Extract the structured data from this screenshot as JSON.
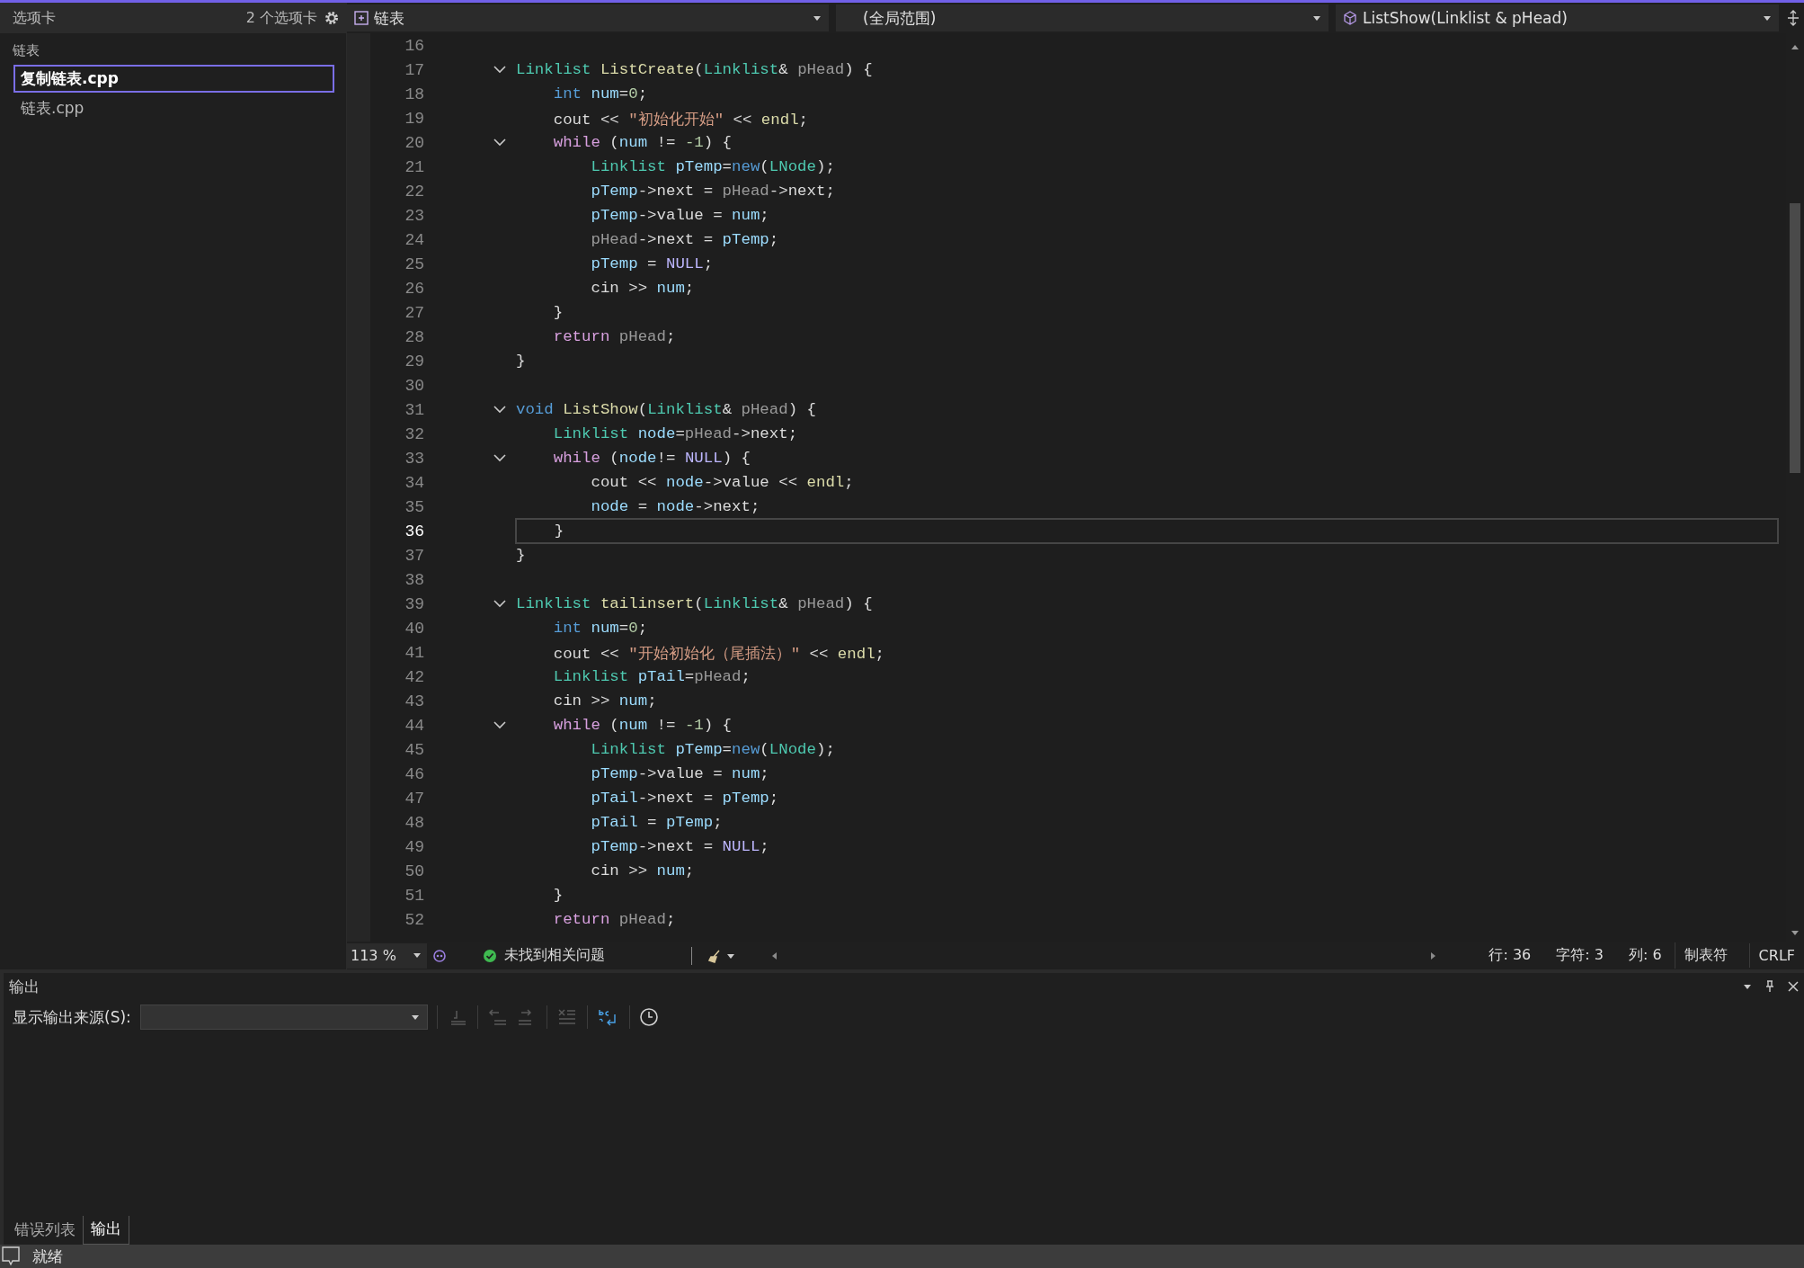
{
  "tabs_panel": {
    "title": "选项卡",
    "count": "2 个选项卡",
    "groups": [
      {
        "label": "链表",
        "files": [
          {
            "name": "复制链表.cpp",
            "selected": true
          },
          {
            "name": "链表.cpp",
            "selected": false
          }
        ]
      }
    ]
  },
  "navigation_bar": {
    "project": "链表",
    "scope": "(全局范围)",
    "member": "ListShow(Linklist & pHead)"
  },
  "editor": {
    "lines": [
      {
        "number": "16",
        "fold": false,
        "current": false
      },
      {
        "number": "17",
        "fold": true,
        "current": false,
        "tokens": [
          {
            "kind": "type",
            "text": "Linklist "
          },
          {
            "kind": "func",
            "text": "ListCreate"
          },
          {
            "kind": "plain",
            "text": "("
          },
          {
            "kind": "type",
            "text": "Linklist"
          },
          {
            "kind": "plain",
            "text": "& "
          },
          {
            "kind": "param",
            "text": "pHead"
          },
          {
            "kind": "plain",
            "text": ") {"
          }
        ]
      },
      {
        "number": "18",
        "fold": false,
        "current": false,
        "tokens": [
          {
            "kind": "kw",
            "text": "    int "
          },
          {
            "kind": "var",
            "text": "num"
          },
          {
            "kind": "plain",
            "text": "="
          },
          {
            "kind": "num",
            "text": "0"
          },
          {
            "kind": "plain",
            "text": ";"
          }
        ]
      },
      {
        "number": "19",
        "fold": false,
        "current": false,
        "tokens": [
          {
            "kind": "plain",
            "text": "    cout << "
          },
          {
            "kind": "str",
            "text": "\"初始化开始\""
          },
          {
            "kind": "plain",
            "text": " << "
          },
          {
            "kind": "func",
            "text": "endl"
          },
          {
            "kind": "plain",
            "text": ";"
          }
        ]
      },
      {
        "number": "20",
        "fold": true,
        "current": false,
        "tokens": [
          {
            "kind": "ctrl",
            "text": "    while"
          },
          {
            "kind": "plain",
            "text": " ("
          },
          {
            "kind": "var",
            "text": "num"
          },
          {
            "kind": "plain",
            "text": " != "
          },
          {
            "kind": "num",
            "text": "-1"
          },
          {
            "kind": "plain",
            "text": ") {"
          }
        ]
      },
      {
        "number": "21",
        "fold": false,
        "current": false,
        "tokens": [
          {
            "kind": "type",
            "text": "        Linklist "
          },
          {
            "kind": "var",
            "text": "pTemp"
          },
          {
            "kind": "plain",
            "text": "="
          },
          {
            "kind": "kw",
            "text": "new"
          },
          {
            "kind": "plain",
            "text": "("
          },
          {
            "kind": "type",
            "text": "LNode"
          },
          {
            "kind": "plain",
            "text": ");"
          }
        ]
      },
      {
        "number": "22",
        "fold": false,
        "current": false,
        "tokens": [
          {
            "kind": "var",
            "text": "        pTemp"
          },
          {
            "kind": "plain",
            "text": "->next = "
          },
          {
            "kind": "param",
            "text": "pHead"
          },
          {
            "kind": "plain",
            "text": "->next;"
          }
        ]
      },
      {
        "number": "23",
        "fold": false,
        "current": false,
        "tokens": [
          {
            "kind": "var",
            "text": "        pTemp"
          },
          {
            "kind": "plain",
            "text": "->value = "
          },
          {
            "kind": "var",
            "text": "num"
          },
          {
            "kind": "plain",
            "text": ";"
          }
        ]
      },
      {
        "number": "24",
        "fold": false,
        "current": false,
        "tokens": [
          {
            "kind": "param",
            "text": "        pHead"
          },
          {
            "kind": "plain",
            "text": "->next = "
          },
          {
            "kind": "var",
            "text": "pTemp"
          },
          {
            "kind": "plain",
            "text": ";"
          }
        ]
      },
      {
        "number": "25",
        "fold": false,
        "current": false,
        "tokens": [
          {
            "kind": "var",
            "text": "        pTemp"
          },
          {
            "kind": "plain",
            "text": " = "
          },
          {
            "kind": "macro",
            "text": "NULL"
          },
          {
            "kind": "plain",
            "text": ";"
          }
        ]
      },
      {
        "number": "26",
        "fold": false,
        "current": false,
        "tokens": [
          {
            "kind": "plain",
            "text": "        cin >> "
          },
          {
            "kind": "var",
            "text": "num"
          },
          {
            "kind": "plain",
            "text": ";"
          }
        ]
      },
      {
        "number": "27",
        "fold": false,
        "current": false,
        "tokens": [
          {
            "kind": "plain",
            "text": "    }"
          }
        ]
      },
      {
        "number": "28",
        "fold": false,
        "current": false,
        "tokens": [
          {
            "kind": "ctrl",
            "text": "    return "
          },
          {
            "kind": "param",
            "text": "pHead"
          },
          {
            "kind": "plain",
            "text": ";"
          }
        ]
      },
      {
        "number": "29",
        "fold": false,
        "current": false,
        "tokens": [
          {
            "kind": "plain",
            "text": "}"
          }
        ]
      },
      {
        "number": "30",
        "fold": false,
        "current": false
      },
      {
        "number": "31",
        "fold": true,
        "current": false,
        "tokens": [
          {
            "kind": "kw",
            "text": "void "
          },
          {
            "kind": "func",
            "text": "ListShow"
          },
          {
            "kind": "plain",
            "text": "("
          },
          {
            "kind": "type",
            "text": "Linklist"
          },
          {
            "kind": "plain",
            "text": "& "
          },
          {
            "kind": "param",
            "text": "pHead"
          },
          {
            "kind": "plain",
            "text": ") {"
          }
        ]
      },
      {
        "number": "32",
        "fold": false,
        "current": false,
        "tokens": [
          {
            "kind": "type",
            "text": "    Linklist "
          },
          {
            "kind": "var",
            "text": "node"
          },
          {
            "kind": "plain",
            "text": "="
          },
          {
            "kind": "param",
            "text": "pHead"
          },
          {
            "kind": "plain",
            "text": "->next;"
          }
        ]
      },
      {
        "number": "33",
        "fold": true,
        "current": false,
        "tokens": [
          {
            "kind": "ctrl",
            "text": "    while"
          },
          {
            "kind": "plain",
            "text": " ("
          },
          {
            "kind": "var",
            "text": "node"
          },
          {
            "kind": "plain",
            "text": "!= "
          },
          {
            "kind": "macro",
            "text": "NULL"
          },
          {
            "kind": "plain",
            "text": ") {"
          }
        ]
      },
      {
        "number": "34",
        "fold": false,
        "current": false,
        "tokens": [
          {
            "kind": "plain",
            "text": "        cout << "
          },
          {
            "kind": "var",
            "text": "node"
          },
          {
            "kind": "plain",
            "text": "->value << "
          },
          {
            "kind": "func",
            "text": "endl"
          },
          {
            "kind": "plain",
            "text": ";"
          }
        ]
      },
      {
        "number": "35",
        "fold": false,
        "current": false,
        "tokens": [
          {
            "kind": "var",
            "text": "        node"
          },
          {
            "kind": "plain",
            "text": " = "
          },
          {
            "kind": "var",
            "text": "node"
          },
          {
            "kind": "plain",
            "text": "->next;"
          }
        ]
      },
      {
        "number": "36",
        "fold": false,
        "current": true,
        "tokens": [
          {
            "kind": "plain",
            "text": "    }"
          }
        ]
      },
      {
        "number": "37",
        "fold": false,
        "current": false,
        "tokens": [
          {
            "kind": "plain",
            "text": "}"
          }
        ]
      },
      {
        "number": "38",
        "fold": false,
        "current": false
      },
      {
        "number": "39",
        "fold": true,
        "current": false,
        "tokens": [
          {
            "kind": "type",
            "text": "Linklist "
          },
          {
            "kind": "func",
            "text": "tailinsert"
          },
          {
            "kind": "plain",
            "text": "("
          },
          {
            "kind": "type",
            "text": "Linklist"
          },
          {
            "kind": "plain",
            "text": "& "
          },
          {
            "kind": "param",
            "text": "pHead"
          },
          {
            "kind": "plain",
            "text": ") {"
          }
        ]
      },
      {
        "number": "40",
        "fold": false,
        "current": false,
        "tokens": [
          {
            "kind": "kw",
            "text": "    int "
          },
          {
            "kind": "var",
            "text": "num"
          },
          {
            "kind": "plain",
            "text": "="
          },
          {
            "kind": "num",
            "text": "0"
          },
          {
            "kind": "plain",
            "text": ";"
          }
        ]
      },
      {
        "number": "41",
        "fold": false,
        "current": false,
        "tokens": [
          {
            "kind": "plain",
            "text": "    cout << "
          },
          {
            "kind": "str",
            "text": "\"开始初始化（尾插法）\""
          },
          {
            "kind": "plain",
            "text": " << "
          },
          {
            "kind": "func",
            "text": "endl"
          },
          {
            "kind": "plain",
            "text": ";"
          }
        ]
      },
      {
        "number": "42",
        "fold": false,
        "current": false,
        "tokens": [
          {
            "kind": "type",
            "text": "    Linklist "
          },
          {
            "kind": "var",
            "text": "pTail"
          },
          {
            "kind": "plain",
            "text": "="
          },
          {
            "kind": "param",
            "text": "pHead"
          },
          {
            "kind": "plain",
            "text": ";"
          }
        ]
      },
      {
        "number": "43",
        "fold": false,
        "current": false,
        "tokens": [
          {
            "kind": "plain",
            "text": "    cin >> "
          },
          {
            "kind": "var",
            "text": "num"
          },
          {
            "kind": "plain",
            "text": ";"
          }
        ]
      },
      {
        "number": "44",
        "fold": true,
        "current": false,
        "tokens": [
          {
            "kind": "ctrl",
            "text": "    while"
          },
          {
            "kind": "plain",
            "text": " ("
          },
          {
            "kind": "var",
            "text": "num"
          },
          {
            "kind": "plain",
            "text": " != "
          },
          {
            "kind": "num",
            "text": "-1"
          },
          {
            "kind": "plain",
            "text": ") {"
          }
        ]
      },
      {
        "number": "45",
        "fold": false,
        "current": false,
        "tokens": [
          {
            "kind": "type",
            "text": "        Linklist "
          },
          {
            "kind": "var",
            "text": "pTemp"
          },
          {
            "kind": "plain",
            "text": "="
          },
          {
            "kind": "kw",
            "text": "new"
          },
          {
            "kind": "plain",
            "text": "("
          },
          {
            "kind": "type",
            "text": "LNode"
          },
          {
            "kind": "plain",
            "text": ");"
          }
        ]
      },
      {
        "number": "46",
        "fold": false,
        "current": false,
        "tokens": [
          {
            "kind": "var",
            "text": "        pTemp"
          },
          {
            "kind": "plain",
            "text": "->value = "
          },
          {
            "kind": "var",
            "text": "num"
          },
          {
            "kind": "plain",
            "text": ";"
          }
        ]
      },
      {
        "number": "47",
        "fold": false,
        "current": false,
        "tokens": [
          {
            "kind": "var",
            "text": "        pTail"
          },
          {
            "kind": "plain",
            "text": "->next = "
          },
          {
            "kind": "var",
            "text": "pTemp"
          },
          {
            "kind": "plain",
            "text": ";"
          }
        ]
      },
      {
        "number": "48",
        "fold": false,
        "current": false,
        "tokens": [
          {
            "kind": "var",
            "text": "        pTail"
          },
          {
            "kind": "plain",
            "text": " = "
          },
          {
            "kind": "var",
            "text": "pTemp"
          },
          {
            "kind": "plain",
            "text": ";"
          }
        ]
      },
      {
        "number": "49",
        "fold": false,
        "current": false,
        "tokens": [
          {
            "kind": "var",
            "text": "        pTemp"
          },
          {
            "kind": "plain",
            "text": "->next = "
          },
          {
            "kind": "macro",
            "text": "NULL"
          },
          {
            "kind": "plain",
            "text": ";"
          }
        ]
      },
      {
        "number": "50",
        "fold": false,
        "current": false,
        "tokens": [
          {
            "kind": "plain",
            "text": "        cin >> "
          },
          {
            "kind": "var",
            "text": "num"
          },
          {
            "kind": "plain",
            "text": ";"
          }
        ]
      },
      {
        "number": "51",
        "fold": false,
        "current": false,
        "tokens": [
          {
            "kind": "plain",
            "text": "    }"
          }
        ]
      },
      {
        "number": "52",
        "fold": false,
        "current": false,
        "tokens": [
          {
            "kind": "ctrl",
            "text": "    return "
          },
          {
            "kind": "param",
            "text": "pHead"
          },
          {
            "kind": "plain",
            "text": ";"
          }
        ]
      }
    ]
  },
  "editor_status": {
    "zoom": "113 %",
    "issues": "未找到相关问题",
    "line": "行: 36",
    "char": "字符: 3",
    "column": "列: 6",
    "indent": "制表符",
    "line_ending": "CRLF"
  },
  "output_panel": {
    "title": "输出",
    "source_label": "显示输出来源(S):",
    "tabs": [
      {
        "label": "错误列表",
        "selected": false
      },
      {
        "label": "输出",
        "selected": true
      }
    ]
  },
  "status_bar": {
    "text": "就绪"
  }
}
